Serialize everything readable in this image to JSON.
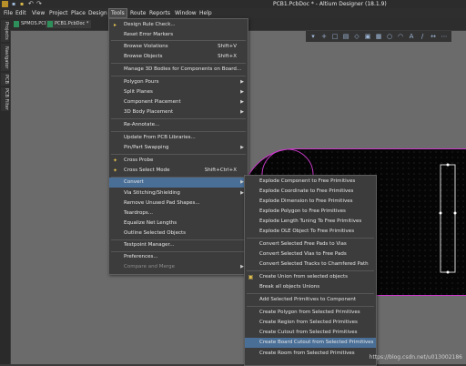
{
  "window": {
    "title": "PCB1.PcbDoc * - Altium Designer (18.1.9)"
  },
  "menu": {
    "items": [
      "File",
      "Edit",
      "View",
      "Project",
      "Place",
      "Design",
      "Tools",
      "Route",
      "Reports",
      "Window",
      "Help"
    ]
  },
  "tabs": [
    {
      "label": "SPMOS.PCB"
    },
    {
      "label": "PCB1.PcbDoc *"
    }
  ],
  "left_panel": {
    "tabs": [
      "Projects",
      "Navigator",
      "PCB",
      "PCB Filter"
    ]
  },
  "tools_menu": {
    "items": [
      {
        "label": "Design Rule Check...",
        "shortcut": "",
        "submenu": false
      },
      {
        "label": "Reset Error Markers",
        "shortcut": "",
        "submenu": false
      },
      {
        "label": "Browse Violations",
        "shortcut": "Shift+V",
        "submenu": false
      },
      {
        "label": "Browse Objects",
        "shortcut": "Shift+X",
        "submenu": false
      },
      {
        "label": "Manage 3D Bodies for Components on Board...",
        "shortcut": "",
        "submenu": false
      },
      {
        "label": "Polygon Pours",
        "shortcut": "",
        "submenu": true
      },
      {
        "label": "Split Planes",
        "shortcut": "",
        "submenu": true
      },
      {
        "label": "Component Placement",
        "shortcut": "",
        "submenu": true
      },
      {
        "label": "3D Body Placement",
        "shortcut": "",
        "submenu": true
      },
      {
        "label": "Re-Annotate...",
        "shortcut": "",
        "submenu": false
      },
      {
        "label": "Update From PCB Libraries...",
        "shortcut": "",
        "submenu": false
      },
      {
        "label": "Pin/Part Swapping",
        "shortcut": "",
        "submenu": true
      },
      {
        "label": "Cross Probe",
        "shortcut": "",
        "submenu": false
      },
      {
        "label": "Cross Select Mode",
        "shortcut": "Shift+Ctrl+X",
        "submenu": false
      },
      {
        "label": "Convert",
        "shortcut": "",
        "submenu": true
      },
      {
        "label": "Via Stitching/Shielding",
        "shortcut": "",
        "submenu": true
      },
      {
        "label": "Remove Unused Pad Shapes...",
        "shortcut": "",
        "submenu": false
      },
      {
        "label": "Teardrops...",
        "shortcut": "",
        "submenu": false
      },
      {
        "label": "Equalize Net Lengths",
        "shortcut": "",
        "submenu": false
      },
      {
        "label": "Outline Selected Objects",
        "shortcut": "",
        "submenu": false
      },
      {
        "label": "Testpoint Manager...",
        "shortcut": "",
        "submenu": false
      },
      {
        "label": "Preferences...",
        "shortcut": "",
        "submenu": false
      },
      {
        "label": "Compare and Merge",
        "shortcut": "",
        "submenu": true
      }
    ]
  },
  "convert_menu": {
    "items": [
      "Explode Component to Free Primitives",
      "Explode Coordinate to Free Primitives",
      "Explode Dimension to Free Primitives",
      "Explode Polygon to Free Primitives",
      "Explode Length Tuning To Free Primitives",
      "Explode OLE Object To Free Primitives",
      "Convert Selected Free Pads to Vias",
      "Convert Selected Vias to Free Pads",
      "Convert Selected Tracks to Chamfered Path",
      "Create Union from selected objects",
      "Break all objects Unions",
      "Add Selected Primitives to Component",
      "Create Polygon from Selected Primitives",
      "Create Region from Selected Primitives",
      "Create Cutout from Selected Primitives",
      "Create Board Cutout from Selected Primitives",
      "Create Room from Selected Primitives"
    ]
  },
  "watermark": "https://blog.csdn.net/u013002186",
  "colors": {
    "highlight": "#4a6f97",
    "board_outline": "#c83ac8"
  }
}
